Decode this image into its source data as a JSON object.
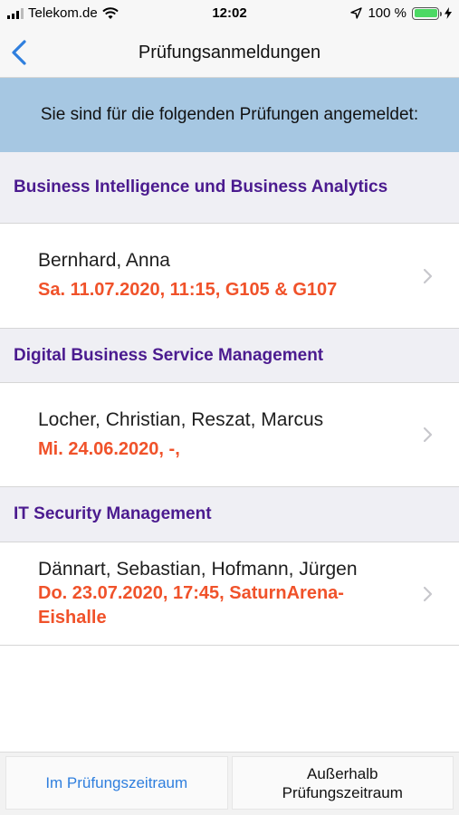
{
  "status_bar": {
    "carrier": "Telekom.de",
    "time": "12:02",
    "battery_percent": "100 %",
    "battery_level": 1.0
  },
  "nav": {
    "title": "Prüfungsanmeldungen"
  },
  "banner": {
    "text": "Sie sind für die folgenden Prüfungen angemeldet:"
  },
  "exams": [
    {
      "course": "Business Intelligence und Business Analytics",
      "examiners": "Bernhard,  Anna",
      "details": "Sa. 11.07.2020, 11:15, G105 & G107"
    },
    {
      "course": "Digital Business Service Management",
      "examiners": "Locher,  Christian, Reszat,  Marcus",
      "details": "Mi. 24.06.2020, -,"
    },
    {
      "course": "IT Security Management",
      "examiners": "Dännart,  Sebastian, Hofmann, Jürgen",
      "details": "Do. 23.07.2020, 17:45, SaturnArena-Eishalle"
    }
  ],
  "tabs": {
    "in_period": "Im Prüfungszeitraum",
    "out_period_line1": "Außerhalb",
    "out_period_line2": "Prüfungszeitraum"
  },
  "colors": {
    "accent_blue": "#2f7fde",
    "course_purple": "#4b1b8f",
    "details_orange": "#f0522a",
    "banner_blue": "#a6c7e2",
    "battery_green": "#4cd964"
  }
}
